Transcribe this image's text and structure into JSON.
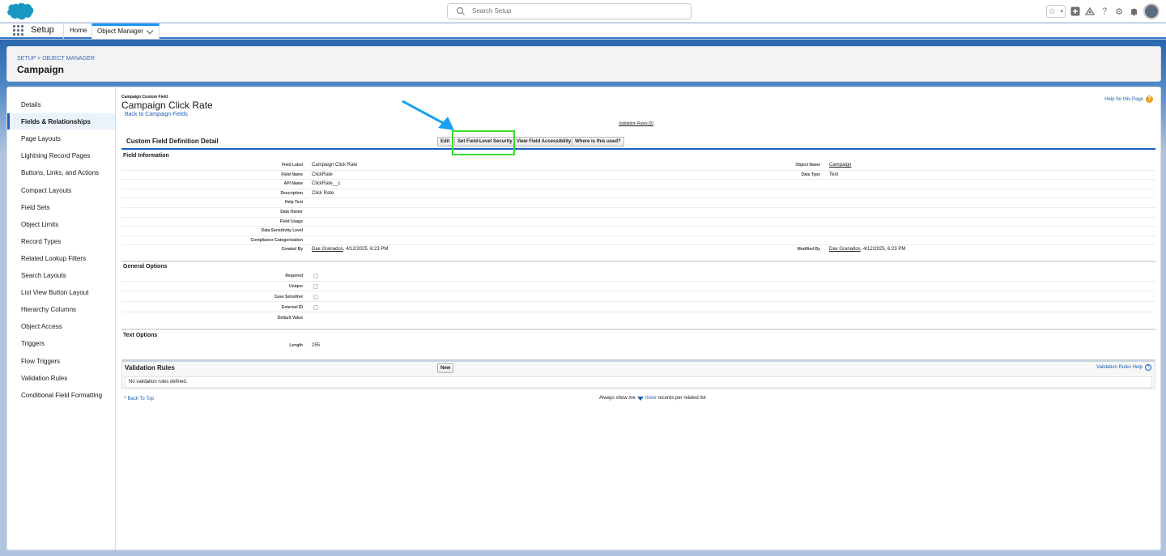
{
  "header": {
    "search_placeholder": "Search Setup"
  },
  "nav": {
    "app_name": "Setup",
    "home": "Home",
    "object_manager": "Object Manager"
  },
  "object_header": {
    "breadcrumb": "SETUP > OBJECT MANAGER",
    "title": "Campaign"
  },
  "sidebar": {
    "items": [
      "Details",
      "Fields & Relationships",
      "Page Layouts",
      "Lightning Record Pages",
      "Buttons, Links, and Actions",
      "Compact Layouts",
      "Field Sets",
      "Object Limits",
      "Record Types",
      "Related Lookup Filters",
      "Search Layouts",
      "List View Button Layout",
      "Hierarchy Columns",
      "Object Access",
      "Triggers",
      "Flow Triggers",
      "Validation Rules",
      "Conditional Field Formatting"
    ],
    "active_index": 1
  },
  "page": {
    "type": "Campaign Custom Field",
    "title": "Campaign Click Rate",
    "back_link": "Back to Campaign Fields",
    "help_link": "Help for this Page",
    "validation_rules_link": "Validation Rules [0]"
  },
  "detail": {
    "title": "Custom Field Definition Detail",
    "buttons": {
      "edit": "Edit",
      "set_fls": "Set Field-Level Security",
      "view_access": "View Field Accessibility",
      "where_used": "Where is this used?"
    }
  },
  "field_information": {
    "title": "Field Information",
    "rows": [
      {
        "label": "Field Label",
        "value": "Campaign Click Rate"
      },
      {
        "label": "Field Name",
        "value": "ClickRate"
      },
      {
        "label": "API Name",
        "value": "ClickRate__c"
      },
      {
        "label": "Description",
        "value": "Click Rate"
      },
      {
        "label": "Help Text",
        "value": ""
      },
      {
        "label": "Data Owner",
        "value": ""
      },
      {
        "label": "Field Usage",
        "value": ""
      },
      {
        "label": "Data Sensitivity Level",
        "value": ""
      },
      {
        "label": "Compliance Categorization",
        "value": ""
      },
      {
        "label": "Created By",
        "value": ""
      }
    ],
    "created_by_user": "Dax Granados",
    "created_by_date": ", 4/12/2025, 6:23 PM",
    "object_name_label": "Object Name",
    "object_name_value": "Campaign",
    "data_type_label": "Data Type",
    "data_type_value": "Text",
    "modified_by_label": "Modified By",
    "modified_by_user": "Dax Granados",
    "modified_by_date": ", 4/12/2025, 6:23 PM"
  },
  "general_options": {
    "title": "General Options",
    "rows": [
      "Required",
      "Unique",
      "Case Sensitive",
      "External ID",
      "Default Value"
    ]
  },
  "text_options": {
    "title": "Text Options",
    "length_label": "Length",
    "length_value": "255"
  },
  "validation_rules": {
    "title": "Validation Rules",
    "new_button": "New",
    "help": "Validation Rules Help",
    "empty": "No validation rules defined."
  },
  "footer": {
    "back_to_top": "Back To Top",
    "always_show": "Always show me",
    "more": "more",
    "records_per": "records per related list"
  }
}
